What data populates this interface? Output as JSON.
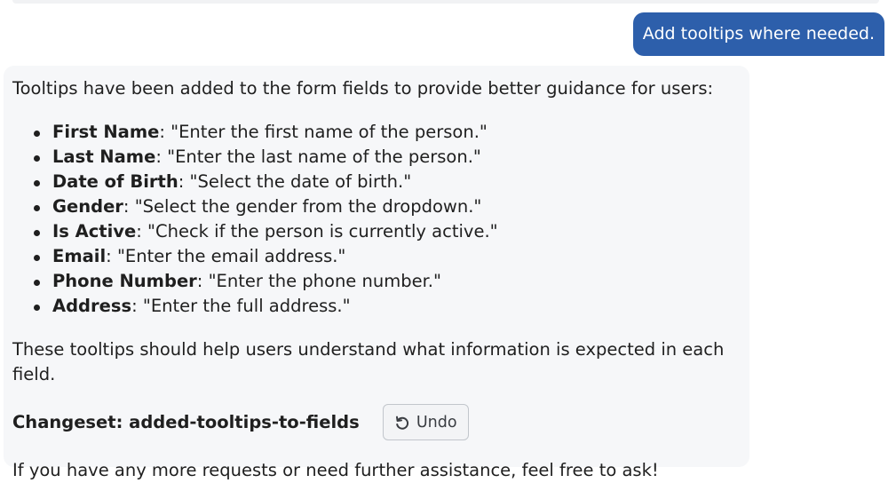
{
  "user_message": {
    "text": "Add tooltips where needed."
  },
  "assistant_message": {
    "intro": "Tooltips have been added to the form fields to provide better guidance for users:",
    "tooltips": [
      {
        "field": "First Name",
        "text": ": \"Enter the first name of the person.\""
      },
      {
        "field": "Last Name",
        "text": ": \"Enter the last name of the person.\""
      },
      {
        "field": "Date of Birth",
        "text": ": \"Select the date of birth.\""
      },
      {
        "field": "Gender",
        "text": ": \"Select the gender from the dropdown.\""
      },
      {
        "field": "Is Active",
        "text": ": \"Check if the person is currently active.\""
      },
      {
        "field": "Email",
        "text": ": \"Enter the email address.\""
      },
      {
        "field": "Phone Number",
        "text": ": \"Enter the phone number.\""
      },
      {
        "field": "Address",
        "text": ": \"Enter the full address.\""
      }
    ],
    "conclusion": "These tooltips should help users understand what information is expected in each field.",
    "changeset_label": "Changeset: added-tooltips-to-fields",
    "undo_label": "Undo",
    "undo_icon": "undo-icon",
    "closing": "If you have any more requests or need further assistance, feel free to ask!"
  },
  "colors": {
    "user_bubble": "#2d5fab",
    "assistant_bubble": "#f6f7f9",
    "text": "#1f1f1f"
  }
}
